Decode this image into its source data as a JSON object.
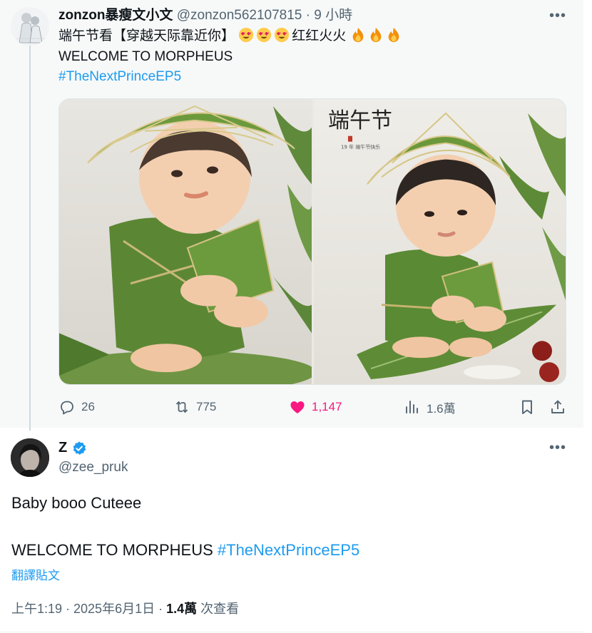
{
  "parent_tweet": {
    "display_name": "zonzon暴瘦文小文",
    "handle": "@zonzon562107815",
    "separator": "·",
    "time": "9 小時",
    "line1_text_a": "端午节看【穿越天际靠近你】",
    "line1_text_b": "红红火火",
    "line2": "WELCOME TO MORPHEUS",
    "hashtag": "#TheNextPrinceEP5",
    "image_calligraphy": "端午节",
    "image_caption": "19 年 端午节快乐",
    "actions": {
      "replies": "26",
      "retweets": "775",
      "likes": "1,147",
      "views": "1.6萬"
    }
  },
  "reply_tweet": {
    "display_name": "Z",
    "handle": "@zee_pruk",
    "line1": "Baby booo Cuteee",
    "line2_text": "WELCOME TO MORPHEUS ",
    "line2_hashtag": "#TheNextPrinceEP5",
    "translate_label": "翻譯貼文",
    "time": "上午1:19 · 2025年6月1日 · ",
    "views": "1.4萬",
    "views_suffix": " 次查看"
  },
  "icons": {
    "more": "more-icon",
    "reply": "reply-icon",
    "retweet": "retweet-icon",
    "like": "heart-icon",
    "views": "analytics-icon",
    "bookmark": "bookmark-icon",
    "share": "share-icon",
    "verified": "verified-badge-icon",
    "emoji_heart_eyes": "heart-eyes-emoji-icon",
    "emoji_fire": "fire-emoji-icon"
  },
  "colors": {
    "link": "#1d9bf0",
    "like": "#f91880",
    "muted": "#536471",
    "text": "#0f1419",
    "parent_bg": "#f7f9f9"
  }
}
